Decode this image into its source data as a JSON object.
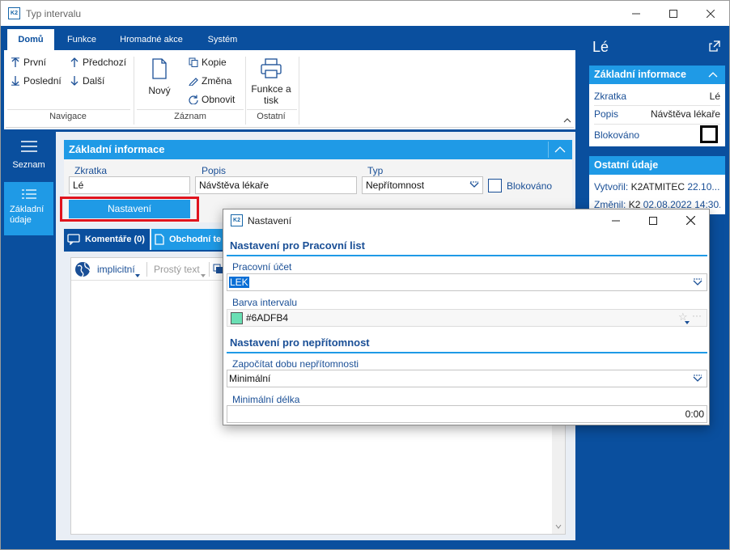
{
  "window": {
    "title": "Typ intervalu"
  },
  "ribbon": {
    "tabs": [
      "Domů",
      "Funkce",
      "Hromadné akce",
      "Systém"
    ],
    "nav": {
      "first": "První",
      "last": "Poslední",
      "prev": "Předchozí",
      "next": "Další",
      "group": "Navigace"
    },
    "record": {
      "new": "Nový",
      "copy": "Kopie",
      "change": "Změna",
      "refresh": "Obnovit",
      "group": "Záznam"
    },
    "other": {
      "print_line1": "Funkce a",
      "print_line2": "tisk",
      "group": "Ostatní"
    }
  },
  "leftnav": {
    "list": "Seznam",
    "basic_line1": "Základní",
    "basic_line2": "údaje"
  },
  "main": {
    "section_title": "Základní informace",
    "labels": {
      "code": "Zkratka",
      "desc": "Popis",
      "type": "Typ",
      "blocked": "Blokováno"
    },
    "values": {
      "code": "Lé",
      "desc": "Návštěva lékaře",
      "type": "Nepřítomnost"
    },
    "settings_button": "Nastavení",
    "tabs": {
      "comments": "Komentáře (0)",
      "business": "Obchodní te"
    },
    "editor": {
      "lang": "implicitní",
      "format": "Prostý text"
    }
  },
  "right": {
    "title": "Lé",
    "basic": {
      "title": "Základní informace",
      "code_label": "Zkratka",
      "code_value": "Lé",
      "desc_label": "Popis",
      "desc_value": "Návštěva lékaře",
      "blocked_label": "Blokováno"
    },
    "other": {
      "title": "Ostatní údaje",
      "created_label": "Vytvořil:",
      "created_value": "K2ATMITEC",
      "created_date": "22.10....",
      "changed_label": "Změnil:",
      "changed_value": "K2",
      "changed_date": "02.08.2022 14:30..."
    }
  },
  "dialog": {
    "title": "Nastavení",
    "sec1": "Nastavení pro Pracovní list",
    "account_label": "Pracovní účet",
    "account_value": "LEK",
    "color_label": "Barva intervalu",
    "color_value": "#6ADFB4",
    "sec2": "Nastavení pro nepřítomnost",
    "count_label": "Započítat dobu nepřítomnosti",
    "count_value": "Minimální",
    "min_label": "Minimální délka",
    "min_value": "0:00"
  },
  "colors": {
    "brand": "#0a4f9e",
    "accent": "#1f9ae6",
    "highlight": "#e0141e",
    "swatch": "#6ADFB4"
  }
}
